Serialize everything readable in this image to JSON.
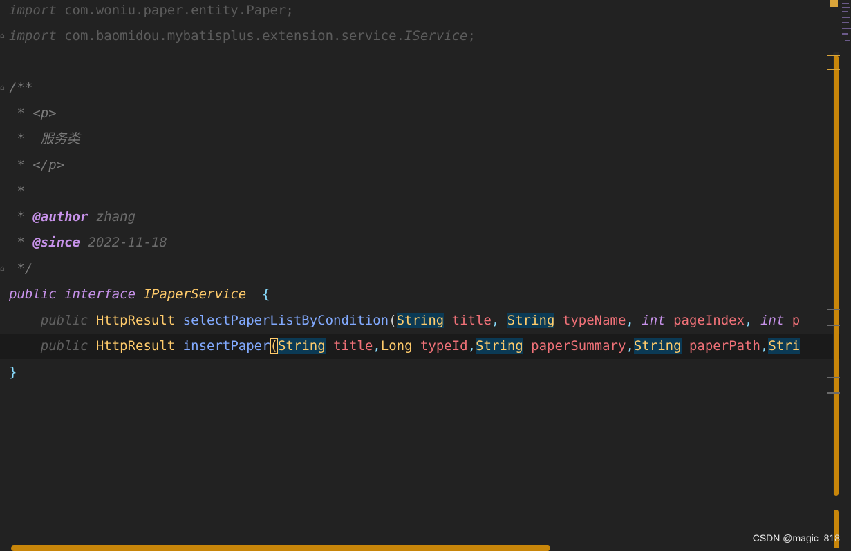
{
  "editor": {
    "lines": {
      "l1": {
        "kw": "import",
        "pkg": "com.woniu.paper.entity.Paper;"
      },
      "l2": {
        "kw": "import",
        "pkg": "com.baomidou.mybatisplus.extension.service.",
        "cls": "IService",
        "end": ";"
      },
      "l4": {
        "text": "/**"
      },
      "l5": {
        "text": " * <p>"
      },
      "l6": {
        "text": " *  服务类"
      },
      "l7": {
        "text": " * </p>"
      },
      "l8": {
        "text": " *"
      },
      "l9": {
        "prefix": " * ",
        "tag": "@author",
        "value": " zhang"
      },
      "l10": {
        "prefix": " * ",
        "tag": "@since",
        "value": " 2022-11-18"
      },
      "l11": {
        "text": " */"
      },
      "l12": {
        "kw1": "public",
        "kw2": "interface",
        "name": "IPaperService",
        "brace": "{"
      },
      "l13": {
        "kw": "public",
        "ret": "HttpResult",
        "method": "selectPaperListByCondition",
        "paren": "(",
        "t1": "String",
        "p1": "title",
        "c1": ",",
        "t2": "String",
        "p2": "typeName",
        "c2": ",",
        "t3": "int",
        "p3": "pageIndex",
        "c3": ",",
        "t4": "int",
        "p4": "p"
      },
      "l14": {
        "kw": "public",
        "ret": "HttpResult",
        "method": "insertPaper",
        "paren": "(",
        "t1": "String",
        "p1": "title",
        "c1": ",",
        "t2": "Long",
        "p2": "typeId",
        "c2": ",",
        "t3": "String",
        "p3": "paperSummary",
        "c3": ",",
        "t4": "String",
        "p4": "paperPath",
        "c4": ",",
        "t5": "Stri"
      },
      "l15": {
        "text": "}"
      }
    }
  },
  "watermark": "CSDN @magic_818",
  "colors": {
    "background": "#222222",
    "keyword": "#c792ea",
    "type": "#ffcb6b",
    "method": "#82aaff",
    "param": "#f07178",
    "comment": "#7a7a7a",
    "scrollbar": "#c8860a"
  }
}
